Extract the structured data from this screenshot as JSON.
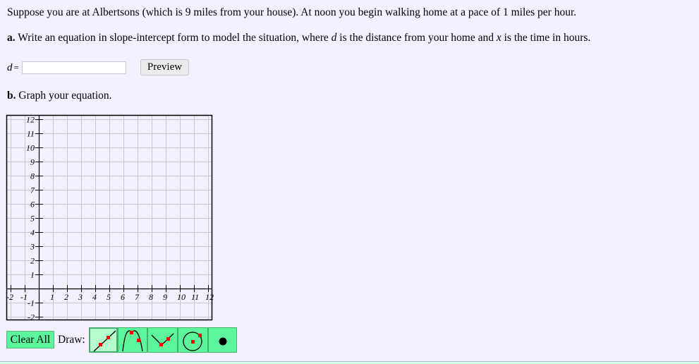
{
  "problem": {
    "intro": "Suppose you are at Albertsons (which is 9 miles from your house). At noon you begin walking home at a pace of 1 miles per hour.",
    "part_a": {
      "label": "a.",
      "text_before_d": " Write an equation in slope-intercept form to model the situation, where ",
      "var_d": "d",
      "text_mid": " is the distance from your home and ",
      "var_x": "x",
      "text_after": " is the time in hours."
    },
    "answer": {
      "var": "d",
      "equals": "=",
      "value": "",
      "placeholder": ""
    },
    "preview_label": "Preview",
    "part_b": {
      "label": "b.",
      "text": " Graph your equation."
    }
  },
  "graph": {
    "x_range": [
      -2,
      12
    ],
    "y_range": [
      -2,
      12
    ],
    "x_tick_labels": [
      "-2",
      "-1",
      "1",
      "2",
      "3",
      "4",
      "5",
      "6",
      "7",
      "8",
      "9",
      "10",
      "11",
      "12"
    ],
    "y_tick_labels": [
      "12",
      "11",
      "10",
      "9",
      "8",
      "7",
      "6",
      "5",
      "4",
      "3",
      "2",
      "1",
      "-1",
      "-2"
    ],
    "grid": true,
    "grid_color": "#c8c8c8"
  },
  "toolbar": {
    "clear_all_label": "Clear All",
    "draw_label": "Draw:",
    "tools": [
      {
        "name": "line-tool",
        "icon": "line-icon",
        "active": true
      },
      {
        "name": "parabola-tool",
        "icon": "parabola-icon",
        "active": false
      },
      {
        "name": "absolute-value-tool",
        "icon": "absolute-value-icon",
        "active": false
      },
      {
        "name": "circle-tool",
        "icon": "circle-icon",
        "active": false
      },
      {
        "name": "point-tool",
        "icon": "point-icon",
        "active": false
      }
    ],
    "accent_color": "#5cf59c",
    "active_color": "#b4fccc",
    "marker_color": "#ff0000"
  }
}
